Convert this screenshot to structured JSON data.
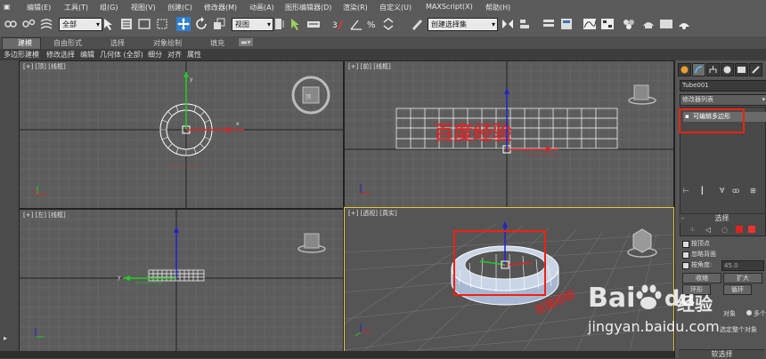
{
  "menu": [
    "编辑(E)",
    "工具(T)",
    "组(G)",
    "视图(V)",
    "创建(C)",
    "修改器(M)",
    "动画(A)",
    "图形编辑器(D)",
    "渲染(R)",
    "自定义(U)",
    "MAXScript(X)",
    "帮助(H)"
  ],
  "toolbar": {
    "selection_filter": "全部",
    "reference_coord": "视图",
    "named_selection_placeholder": "创建选择集"
  },
  "ribbon": {
    "tabs": [
      "建模",
      "自由形式",
      "选择",
      "对象绘制",
      "填充"
    ],
    "sub_items": [
      "多边形建模",
      "修改选择",
      "编辑",
      "几何体 (全部)",
      "细分",
      "对齐",
      "属性"
    ]
  },
  "viewports": {
    "top_left": "[+] [顶] [线框]",
    "top_right": "[+] [前] [线框]",
    "bottom_left": "[+] [左] [线框]",
    "bottom_right": "[+] [透视] [真实]"
  },
  "command_panel": {
    "object_name": "Tube001",
    "modifier_list": "修改器列表",
    "stack_item": "可编辑多边形",
    "selection_rollout": "选择",
    "checkboxes": [
      "按顶点",
      "忽略背面",
      "按角度:"
    ],
    "angle_value": "45.0",
    "buttons": {
      "shrink": "收缩",
      "grow": "扩大",
      "ring": "环形",
      "loop": "循环"
    },
    "preview_label": "对象",
    "preview_option": "多个",
    "status_text": "选定整个对象",
    "bottom_rollout": "软选择"
  },
  "watermark": {
    "brand": "Bai",
    "brand2": "du",
    "brand_cn": "经验",
    "url": "jingyan.baidu.com",
    "overlay_text": "百度经验"
  }
}
